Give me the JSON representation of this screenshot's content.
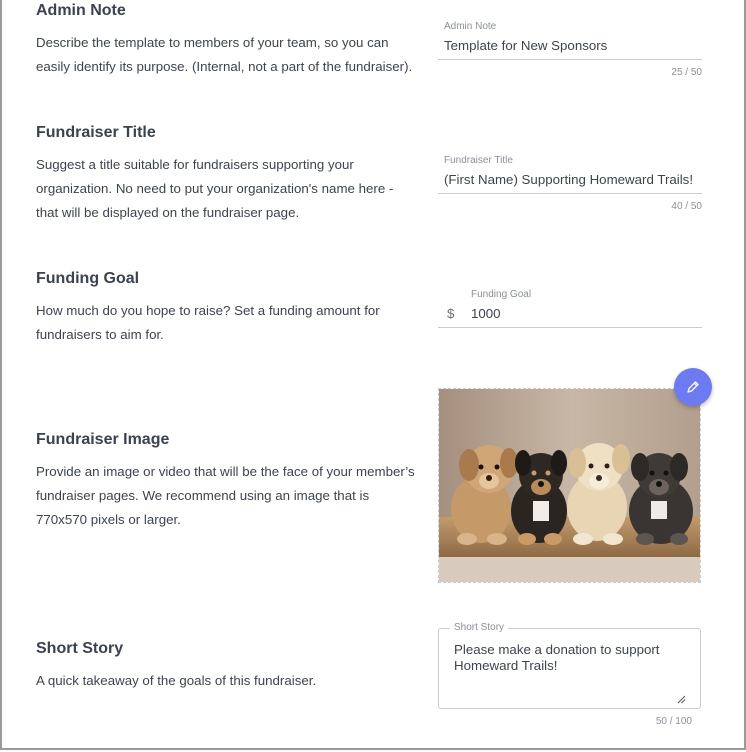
{
  "admin_note": {
    "title": "Admin Note",
    "description": "Describe the template to members of your team, so you can easily identify its purpose. (Internal, not a part of the fundraiser).",
    "field_label": "Admin Note",
    "value": "Template for New Sponsors",
    "counter": "25 / 50"
  },
  "fundraiser_title": {
    "title": "Fundraiser Title",
    "description": "Suggest a title suitable for fundraisers supporting your organization. No need to put your organization's name here - that will be displayed on the fundraiser page.",
    "field_label": "Fundraiser Title",
    "value": "(First Name) Supporting Homeward Trails!",
    "counter": "40 / 50"
  },
  "funding_goal": {
    "title": "Funding Goal",
    "description": "How much do you hope to raise? Set a funding amount for fundraisers to aim for.",
    "field_label": "Funding Goal",
    "currency": "$",
    "value": "1000"
  },
  "fundraiser_image": {
    "title": "Fundraiser Image",
    "description": "Provide an image or video that will be the face of your member’s fundraiser pages. We recommend using an image that is 770x570 pixels or larger.",
    "edit_icon": "pencil-icon",
    "accent_color": "#6d7bf2"
  },
  "short_story": {
    "title": "Short Story",
    "description": "A quick takeaway of the goals of this fundraiser.",
    "field_label": "Short Story",
    "value": "Please make a donation to support Homeward Trails!",
    "counter": "50 / 100"
  }
}
